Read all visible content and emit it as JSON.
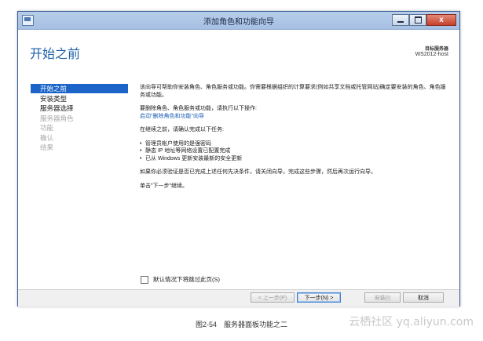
{
  "window": {
    "title": "添加角色和功能向导",
    "close_glyph": "x"
  },
  "header": {
    "page_title": "开始之前",
    "destination_label": "目标服务器",
    "destination_server": "WS2012-host"
  },
  "nav": {
    "items": [
      {
        "label": "开始之前",
        "state": "active"
      },
      {
        "label": "安装类型",
        "state": "enabled"
      },
      {
        "label": "服务器选择",
        "state": "enabled"
      },
      {
        "label": "服务器角色",
        "state": "disabled"
      },
      {
        "label": "功能",
        "state": "disabled"
      },
      {
        "label": "确认",
        "state": "disabled"
      },
      {
        "label": "结果",
        "state": "disabled"
      }
    ]
  },
  "content": {
    "intro": "该向导可帮助你安装角色、角色服务或功能。你需要根据组织的计算要求(例如共享文档或托管网站)确定要安装的角色、角色服务或功能。",
    "remove_text": "要删除角色、角色服务或功能，请执行以下操作:",
    "remove_link": "启动\"删除角色和功能\"向导",
    "before_continue": "在继续之前，请确认完成以下任务:",
    "bullets": [
      "管理员帐户使用的是强密码",
      "静态 IP 地址等网络设置已配置完成",
      "已从 Windows 更新安装最新的安全更新"
    ],
    "prereq_note": "如果你必须验证是否已完成上述任何先决条件，请关闭向导，完成这些步骤，然后再次运行向导。",
    "next_hint": "单击\"下一步\"继续。"
  },
  "skip_checkbox": {
    "label": "默认情况下将跳过此页(S)",
    "checked": false
  },
  "footer": {
    "prev_label": "< 上一步(P)",
    "next_label": "下一步(N) >",
    "install_label": "安装(I)",
    "cancel_label": "取消"
  },
  "caption": "图2-54　服务器面板功能之二",
  "watermark": "云栖社区 yq.aliyun.com",
  "colors": {
    "accent": "#1c64c8",
    "title": "#1e5fa8",
    "link": "#1a5db4"
  }
}
